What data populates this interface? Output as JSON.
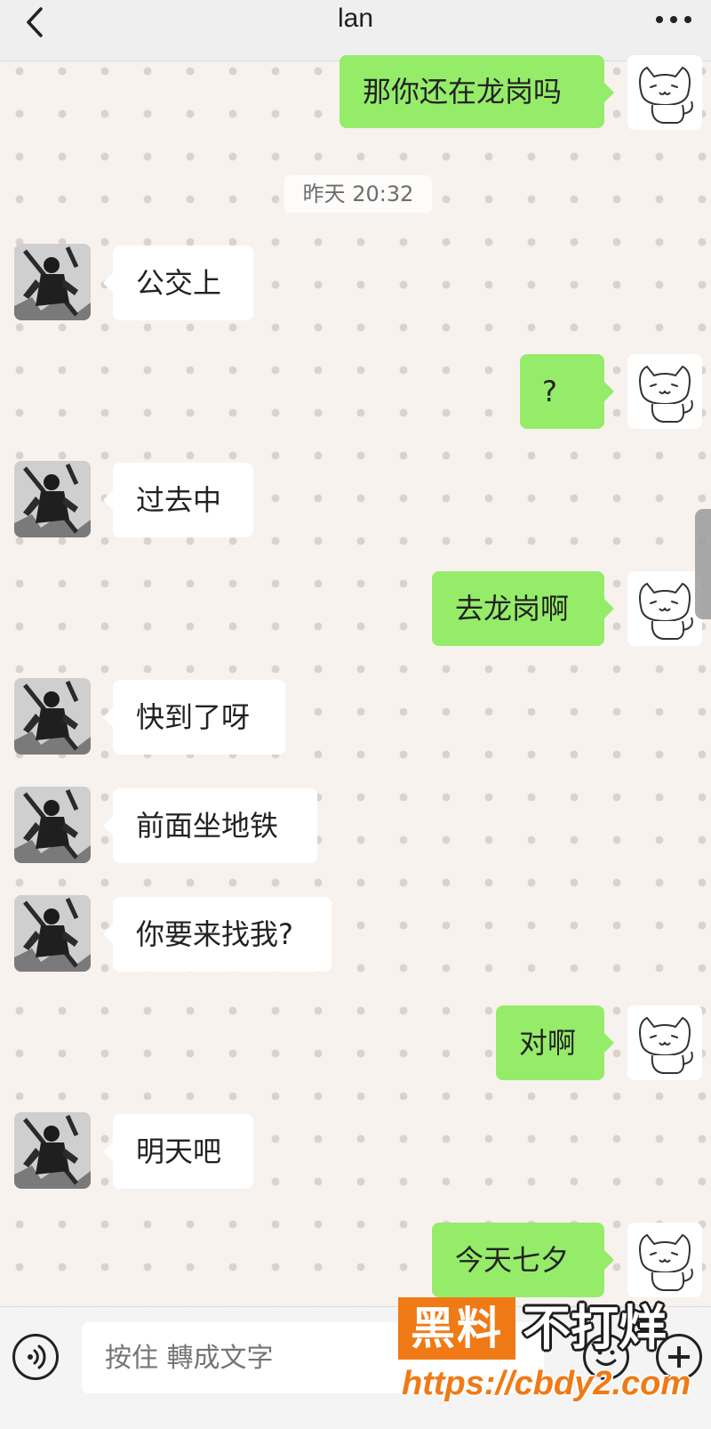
{
  "header": {
    "title": "lan",
    "back_icon": "chevron-left-icon",
    "more_icon": "more-dots-icon"
  },
  "timestamp": "昨天 20:32",
  "messages": [
    {
      "side": "out",
      "text": "那你还在龙岗吗"
    },
    {
      "side": "in",
      "text": "公交上"
    },
    {
      "side": "out",
      "text": "?"
    },
    {
      "side": "in",
      "text": "过去中"
    },
    {
      "side": "out",
      "text": "去龙岗啊"
    },
    {
      "side": "in",
      "text": "快到了呀"
    },
    {
      "side": "in",
      "text": "前面坐地铁"
    },
    {
      "side": "in",
      "text": "你要来找我?"
    },
    {
      "side": "out",
      "text": "对啊"
    },
    {
      "side": "in",
      "text": "明天吧"
    },
    {
      "side": "out",
      "text": "今天七夕"
    }
  ],
  "input_bar": {
    "placeholder": "按住 轉成文字",
    "voice_icon": "voice-icon",
    "emoji_icon": "emoji-icon",
    "plus_icon": "plus-icon"
  },
  "watermark": {
    "badge": "黑料",
    "text": "不打烊",
    "url": "https://cbdy2.com"
  },
  "colors": {
    "sent_bubble": "#95ec69",
    "received_bubble": "#ffffff",
    "background": "#f8f2ef",
    "watermark_orange": "#f07a15"
  }
}
